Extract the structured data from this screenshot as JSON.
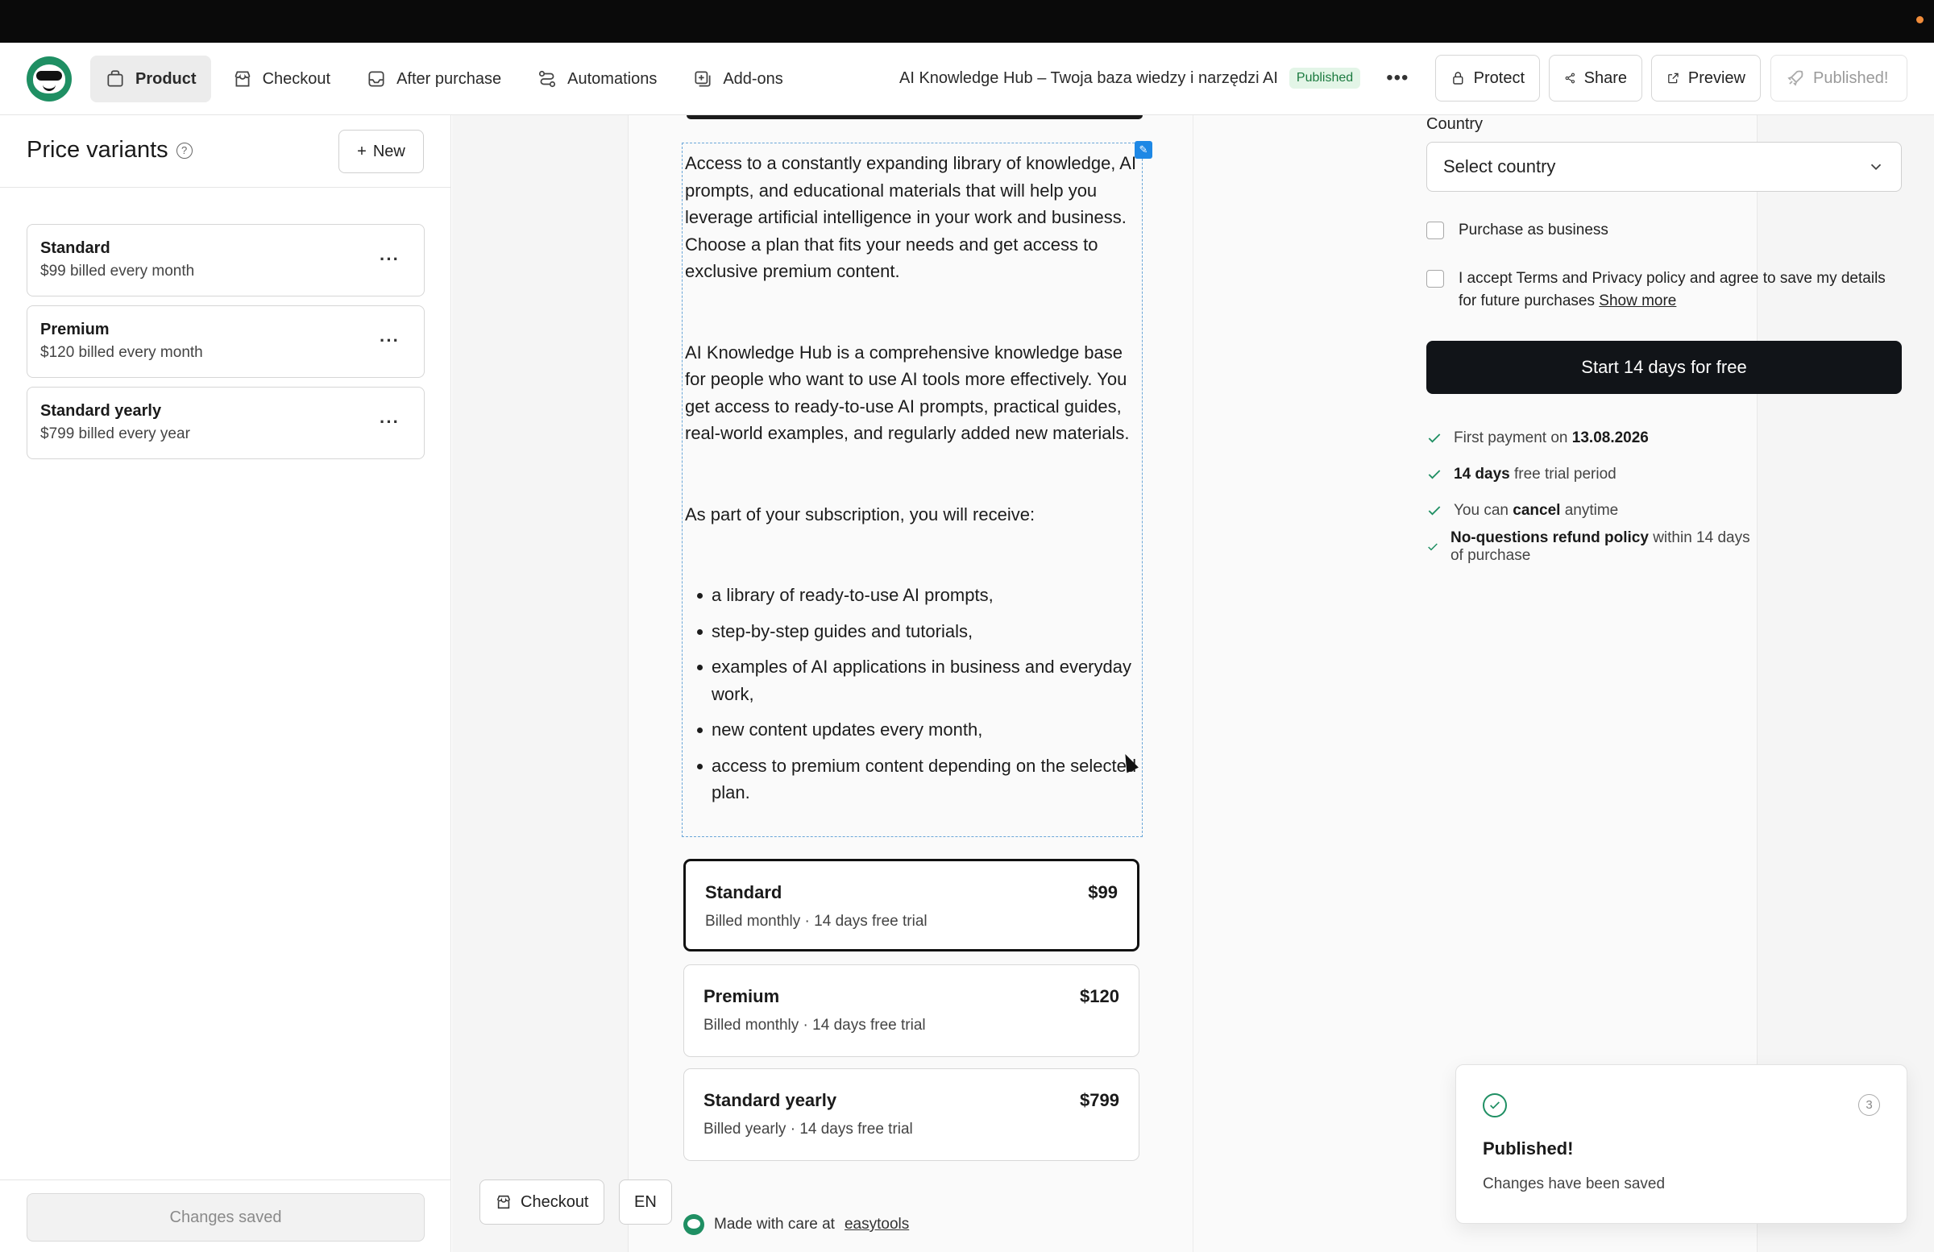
{
  "header": {
    "nav": [
      {
        "label": "Product",
        "icon": "bag-icon",
        "active": true
      },
      {
        "label": "Checkout",
        "icon": "store-icon"
      },
      {
        "label": "After purchase",
        "icon": "inbox-icon"
      },
      {
        "label": "Automations",
        "icon": "workflow-icon"
      },
      {
        "label": "Add-ons",
        "icon": "plus-square-icon"
      }
    ],
    "product_title": "AI Knowledge Hub – Twoja baza wiedzy i narzędzi AI",
    "status_badge": "Published",
    "protect_label": "Protect",
    "share_label": "Share",
    "preview_label": "Preview",
    "published_label": "Published!"
  },
  "sidebar": {
    "title": "Price variants",
    "new_label": "New",
    "variants": [
      {
        "name": "Standard",
        "price": "$99 billed every month"
      },
      {
        "name": "Premium",
        "price": "$120 billed every month"
      },
      {
        "name": "Standard yearly",
        "price": "$799 billed every year"
      }
    ],
    "footer_label": "Changes saved"
  },
  "description": {
    "p1": "Access to a constantly expanding library of knowledge, AI prompts, and educational materials that will help you leverage artificial intelligence in your work and business. Choose a plan that fits your needs and get access to exclusive premium content.",
    "p2": "AI Knowledge Hub is a comprehensive knowledge base for people who want to use AI tools more effectively. You get access to ready-to-use AI prompts, practical guides, real-world examples, and regularly added new materials.",
    "p3": "As part of your subscription, you will receive:",
    "bullets": [
      "a library of ready-to-use AI prompts,",
      "step-by-step guides and tutorials,",
      "examples of AI applications in business and everyday work,",
      "new content updates every month,",
      "access to premium content depending on the selected plan."
    ]
  },
  "plans": [
    {
      "name": "Standard",
      "price": "$99",
      "info": "Billed monthly · 14 days free trial",
      "selected": true
    },
    {
      "name": "Premium",
      "price": "$120",
      "info": "Billed monthly · 14 days free trial"
    },
    {
      "name": "Standard yearly",
      "price": "$799",
      "info": "Billed yearly · 14 days free trial"
    }
  ],
  "checkout": {
    "country_label": "Country",
    "country_placeholder": "Select country",
    "business_label": "Purchase as business",
    "terms_text": "I accept Terms and Privacy policy and agree to save my details for future purchases",
    "terms_link": "Show more",
    "cta_label": "Start 14 days for free",
    "perks": [
      {
        "pre": "First payment on ",
        "bold": "13.08.2026",
        "post": ""
      },
      {
        "pre": "",
        "bold": "14 days",
        "post": " free trial period"
      },
      {
        "pre": "You can ",
        "bold": "cancel",
        "post": " anytime"
      },
      {
        "pre": "",
        "bold": "No-questions refund policy",
        "post": " within 14 days of purchase"
      }
    ]
  },
  "footer": {
    "made_text": "Made with care at",
    "made_link": "easytools",
    "checkout_btn": "Checkout",
    "lang_btn": "EN"
  },
  "toast": {
    "title": "Published!",
    "message": "Changes have been saved",
    "count": "3"
  },
  "colors": {
    "brand": "#1f8f63",
    "cta": "#111418",
    "badge_bg": "#e3f5e7",
    "edit_border": "#6aa6d8"
  }
}
